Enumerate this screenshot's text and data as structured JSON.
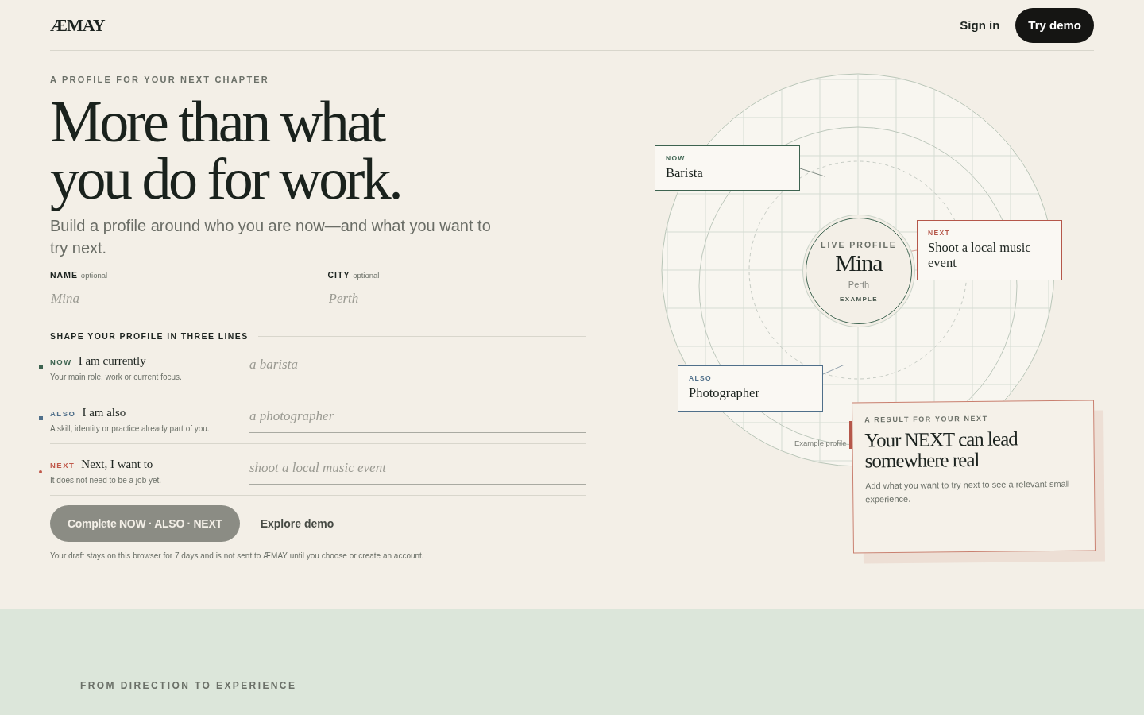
{
  "header": {
    "logo": "ÆMAY",
    "sign_in": "Sign in",
    "try_demo": "Try demo"
  },
  "hero": {
    "eyebrow": "A PROFILE FOR YOUR NEXT CHAPTER",
    "title_lines": [
      "More than what",
      "you do for work."
    ],
    "lead": "Build a profile around who you are now—and what you want to try next."
  },
  "fields": [
    {
      "label": "NAME",
      "hint": "optional",
      "placeholder": "Mina"
    },
    {
      "label": "CITY",
      "hint": "optional",
      "placeholder": "Perth"
    }
  ],
  "lines_heading": "SHAPE YOUR PROFILE IN THREE LINES",
  "lines": [
    {
      "tag": "NOW",
      "prompt": "I am currently",
      "help": "Your main role, work or current focus.",
      "placeholder": "a barista",
      "color": "#3d6350",
      "kind": "square"
    },
    {
      "tag": "ALSO",
      "prompt": "I am also",
      "help": "A skill, identity or practice already part of you.",
      "placeholder": "a photographer",
      "color": "#4f6f8a",
      "kind": "square"
    },
    {
      "tag": "NEXT",
      "prompt": "Next, I want to",
      "help": "It does not need to be a job yet.",
      "placeholder": "shoot a local music event",
      "color": "#c0584a",
      "kind": "dot"
    }
  ],
  "actions": {
    "complete": {
      "label": "Complete NOW · ALSO · NEXT",
      "disabled": true
    },
    "explore": "Explore demo"
  },
  "note": "Your draft stays on this browser for 7 days and is not sent to ÆMAY until you choose or create an account.",
  "diagram": {
    "center": {
      "eyebrow": "LIVE PROFILE",
      "name": "Mina",
      "city": "Perth",
      "badge": "EXAMPLE"
    },
    "cards": [
      {
        "tag": "NOW",
        "text": "Barista",
        "color": "#3d6350"
      },
      {
        "tag": "NEXT",
        "text": "Shoot a local music event",
        "color": "#b5574a"
      },
      {
        "tag": "ALSO",
        "text": "Photographer",
        "color": "#4f6f8a"
      }
    ],
    "caption": "Example profile",
    "result": {
      "eyebrow": "A RESULT FOR YOUR NEXT",
      "title": "Your NEXT can lead somewhere real",
      "body": "Add what you want to try next to see a relevant small experience."
    }
  },
  "section2": {
    "eyebrow": "FROM DIRECTION TO EXPERIENCE"
  }
}
